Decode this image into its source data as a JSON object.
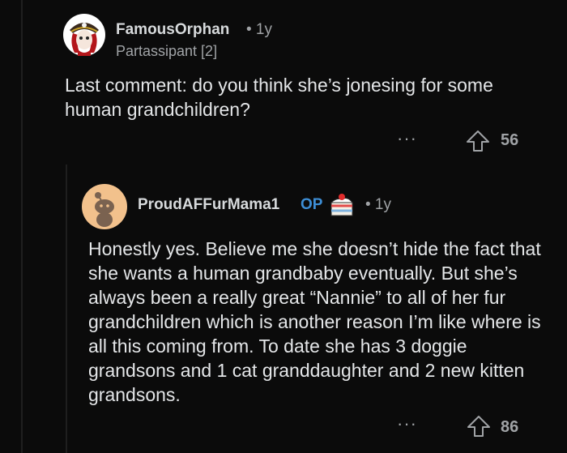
{
  "comments": [
    {
      "username": "FamousOrphan",
      "age": "• 1y",
      "flair": "Partassipant [2]",
      "body": "Last comment: do you think she’s jonesing for some human grandchildren?",
      "more_label": "···",
      "score": "56",
      "avatar_icon": "pirate-avatar-icon"
    },
    {
      "username": "ProudAFFurMama1",
      "op_label": "OP",
      "age": "• 1y",
      "body": "Honestly yes. Believe me she doesn’t hide the fact that she wants a human grandbaby eventually. But she’s always been a really great “Nannie” to all of her fur grandchildren which is another reason I’m like where is all this coming from. To date she has 3 doggie grandsons and 1 cat granddaughter and 2 new kitten grandsons.",
      "more_label": "···",
      "score": "86",
      "avatar_icon": "snoo-avatar-icon",
      "badge_icon": "cake-day-icon"
    }
  ],
  "colors": {
    "background": "#0b0b0b",
    "text": "#e4e6e8",
    "meta": "#a0a3a6",
    "op": "#3d8ed6",
    "avatar_bg": "#f2c18c"
  }
}
